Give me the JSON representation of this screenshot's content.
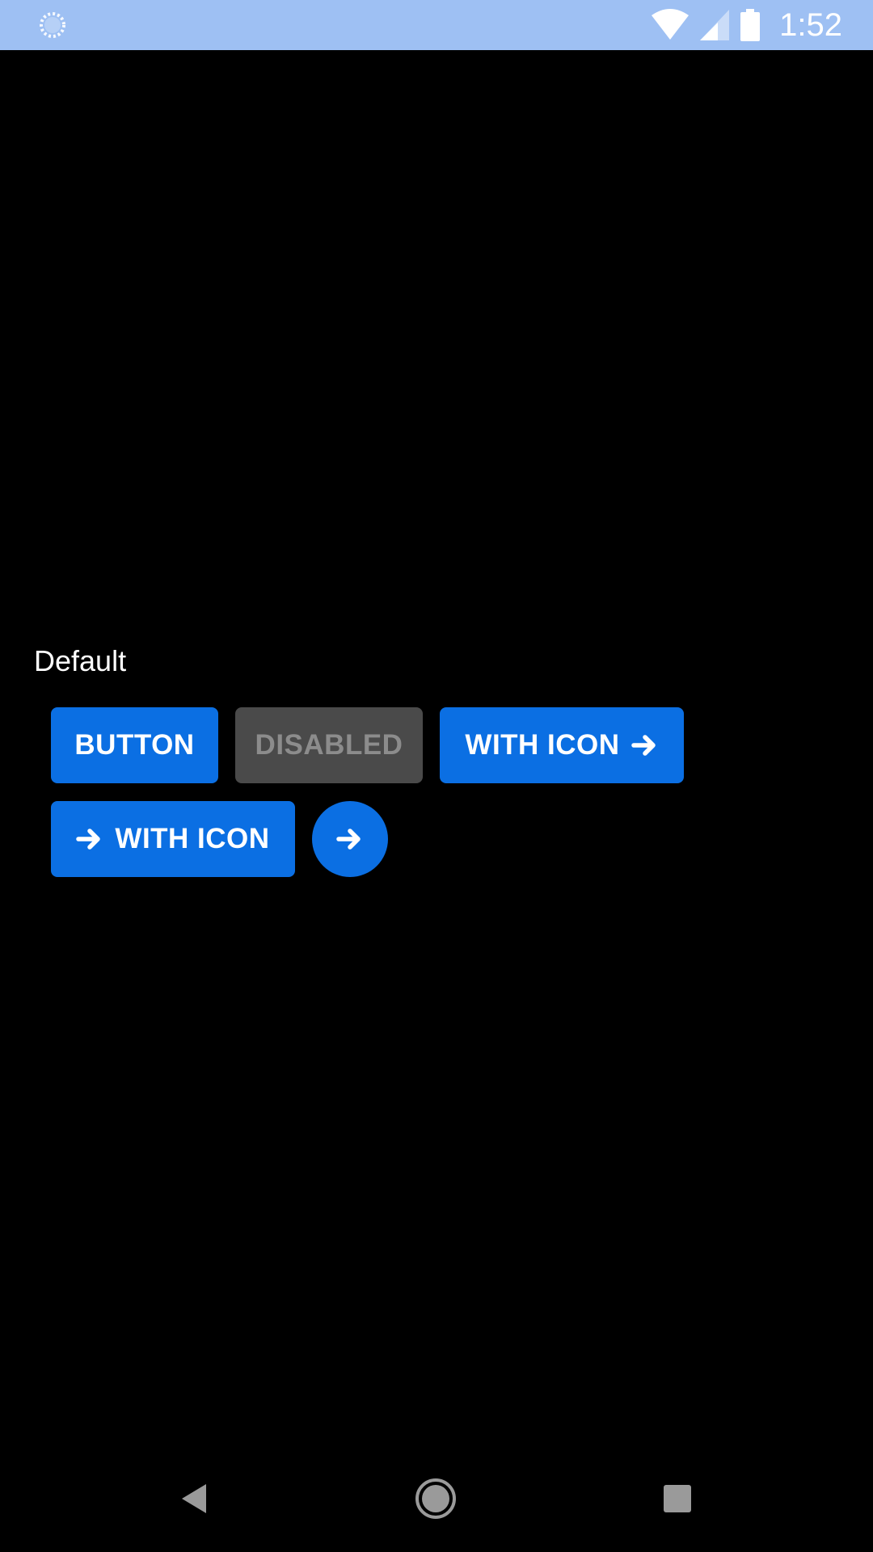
{
  "status_bar": {
    "time": "1:52",
    "icons": [
      "loading-icon",
      "wifi-icon",
      "signal-icon",
      "battery-icon"
    ],
    "background_color": "#9ec0f3"
  },
  "section": {
    "title": "Default"
  },
  "buttons": {
    "primary_label": "BUTTON",
    "disabled_label": "DISABLED",
    "icon_right_label": "WITH ICON",
    "icon_left_label": "WITH ICON",
    "round_icon": "arrow-right-icon",
    "accent_color": "#0b6fe3",
    "disabled_color": "#4a4a4a"
  },
  "nav_bar": {
    "icons": [
      "back-icon",
      "home-icon",
      "recents-icon"
    ]
  }
}
